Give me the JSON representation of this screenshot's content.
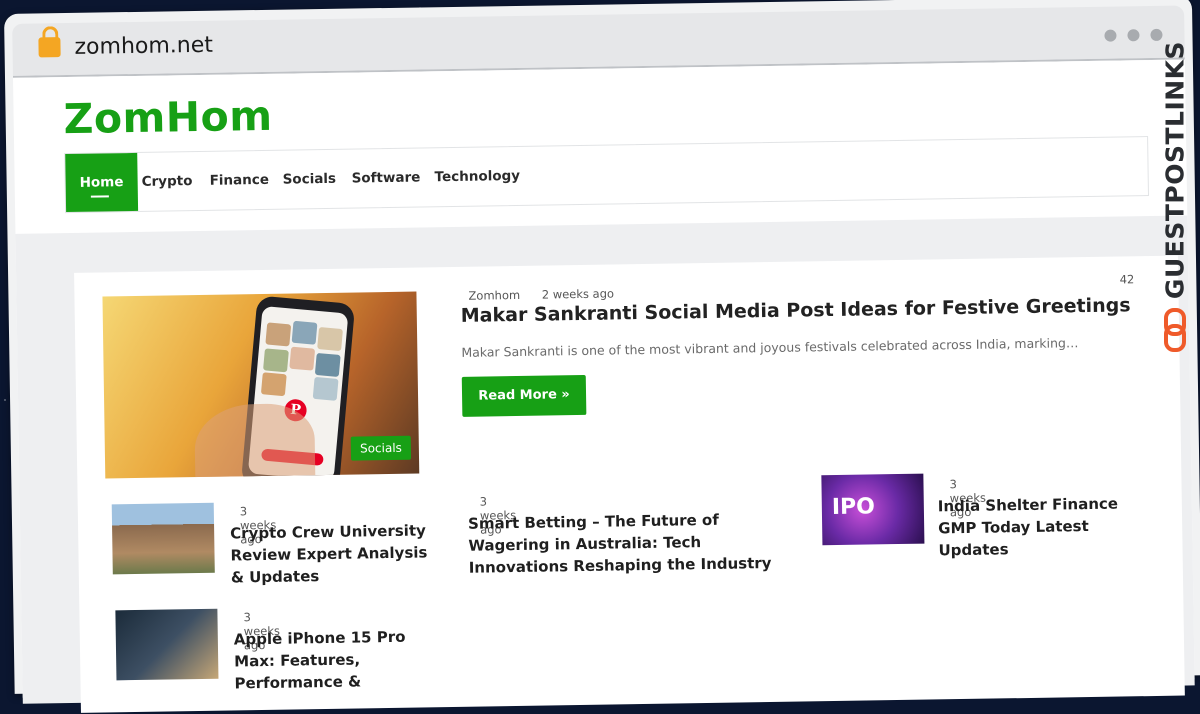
{
  "browser": {
    "url": "zomhom.net"
  },
  "site": {
    "logo": "ZomHom"
  },
  "nav": [
    {
      "label": "Home",
      "active": true
    },
    {
      "label": "Crypto"
    },
    {
      "label": "Finance"
    },
    {
      "label": "Socials"
    },
    {
      "label": "Software"
    },
    {
      "label": "Technology"
    }
  ],
  "featured": {
    "author": "Zomhom",
    "time": "2 weeks ago",
    "comments": "42",
    "title": "Makar Sankranti Social Media Post Ideas for Festive Greetings",
    "excerpt": "Makar Sankranti is one of the most vibrant and joyous festivals celebrated across India, marking…",
    "read_more": "Read More »",
    "category": "Socials"
  },
  "posts": [
    {
      "time": "3 weeks ago",
      "title": "Crypto Crew University Review Expert Analysis & Updates"
    },
    {
      "time": "3 weeks ago",
      "title": "Smart Betting – The Future of Wagering in Australia: Tech Innovations Reshaping the Industry"
    },
    {
      "time": "3 weeks ago",
      "title": "India Shelter Finance GMP Today Latest Updates"
    },
    {
      "time": "3 weeks ago",
      "title": "Apple iPhone 15 Pro Max: Features, Performance &"
    }
  ],
  "side_brand": "GUESTPOSTLINKS",
  "ipo_label": "IPO",
  "colors": {
    "accent": "#17a015",
    "background": "#0b1630",
    "brand_orange": "#ef5a2a"
  }
}
